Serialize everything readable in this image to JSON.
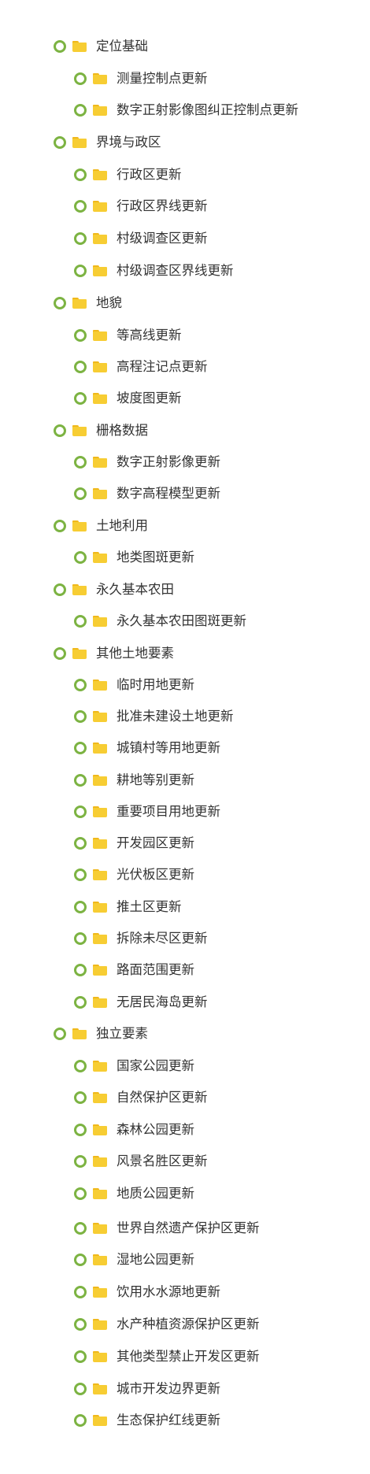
{
  "tree": {
    "nodes": [
      {
        "label": "定位基础",
        "level": 0
      },
      {
        "label": "测量控制点更新",
        "level": 1
      },
      {
        "label": "数字正射影像图纠正控制点更新",
        "level": 1
      },
      {
        "label": "界境与政区",
        "level": 0
      },
      {
        "label": "行政区更新",
        "level": 1
      },
      {
        "label": "行政区界线更新",
        "level": 1
      },
      {
        "label": "村级调查区更新",
        "level": 1
      },
      {
        "label": "村级调查区界线更新",
        "level": 1
      },
      {
        "label": "地貌",
        "level": 0
      },
      {
        "label": "等高线更新",
        "level": 1
      },
      {
        "label": "高程注记点更新",
        "level": 1
      },
      {
        "label": "坡度图更新",
        "level": 1
      },
      {
        "label": "栅格数据",
        "level": 0
      },
      {
        "label": "数字正射影像更新",
        "level": 1
      },
      {
        "label": "数字高程模型更新",
        "level": 1
      },
      {
        "label": "土地利用",
        "level": 0
      },
      {
        "label": "地类图斑更新",
        "level": 1
      },
      {
        "label": "永久基本农田",
        "level": 0
      },
      {
        "label": "永久基本农田图斑更新",
        "level": 1
      },
      {
        "label": "其他土地要素",
        "level": 0
      },
      {
        "label": "临时用地更新",
        "level": 1
      },
      {
        "label": "批准未建设土地更新",
        "level": 1
      },
      {
        "label": "城镇村等用地更新",
        "level": 1
      },
      {
        "label": "耕地等别更新",
        "level": 1
      },
      {
        "label": "重要项目用地更新",
        "level": 1
      },
      {
        "label": "开发园区更新",
        "level": 1
      },
      {
        "label": "光伏板区更新",
        "level": 1
      },
      {
        "label": "推土区更新",
        "level": 1
      },
      {
        "label": "拆除未尽区更新",
        "level": 1
      },
      {
        "label": "路面范围更新",
        "level": 1
      },
      {
        "label": "无居民海岛更新",
        "level": 1
      },
      {
        "label": "独立要素",
        "level": 0
      },
      {
        "label": "国家公园更新",
        "level": 1
      },
      {
        "label": "自然保护区更新",
        "level": 1
      },
      {
        "label": "森林公园更新",
        "level": 1
      },
      {
        "label": "风景名胜区更新",
        "level": 1
      },
      {
        "label": "地质公园更新",
        "level": 1
      },
      {
        "label": "世界自然遗产保护区更新",
        "level": 1
      },
      {
        "label": "湿地公园更新",
        "level": 1
      },
      {
        "label": "饮用水水源地更新",
        "level": 1
      },
      {
        "label": "水产种植资源保护区更新",
        "level": 1
      },
      {
        "label": "其他类型禁止开发区更新",
        "level": 1
      },
      {
        "label": "城市开发边界更新",
        "level": 1
      },
      {
        "label": "生态保护红线更新",
        "level": 1
      }
    ],
    "colors": {
      "toggle_ring": "#7cb342",
      "folder": "#f7cd33",
      "folder_tab": "#f0b81b",
      "text": "#333333"
    },
    "icons": {
      "toggle": "circle-toggle-icon",
      "folder": "folder-icon"
    }
  }
}
